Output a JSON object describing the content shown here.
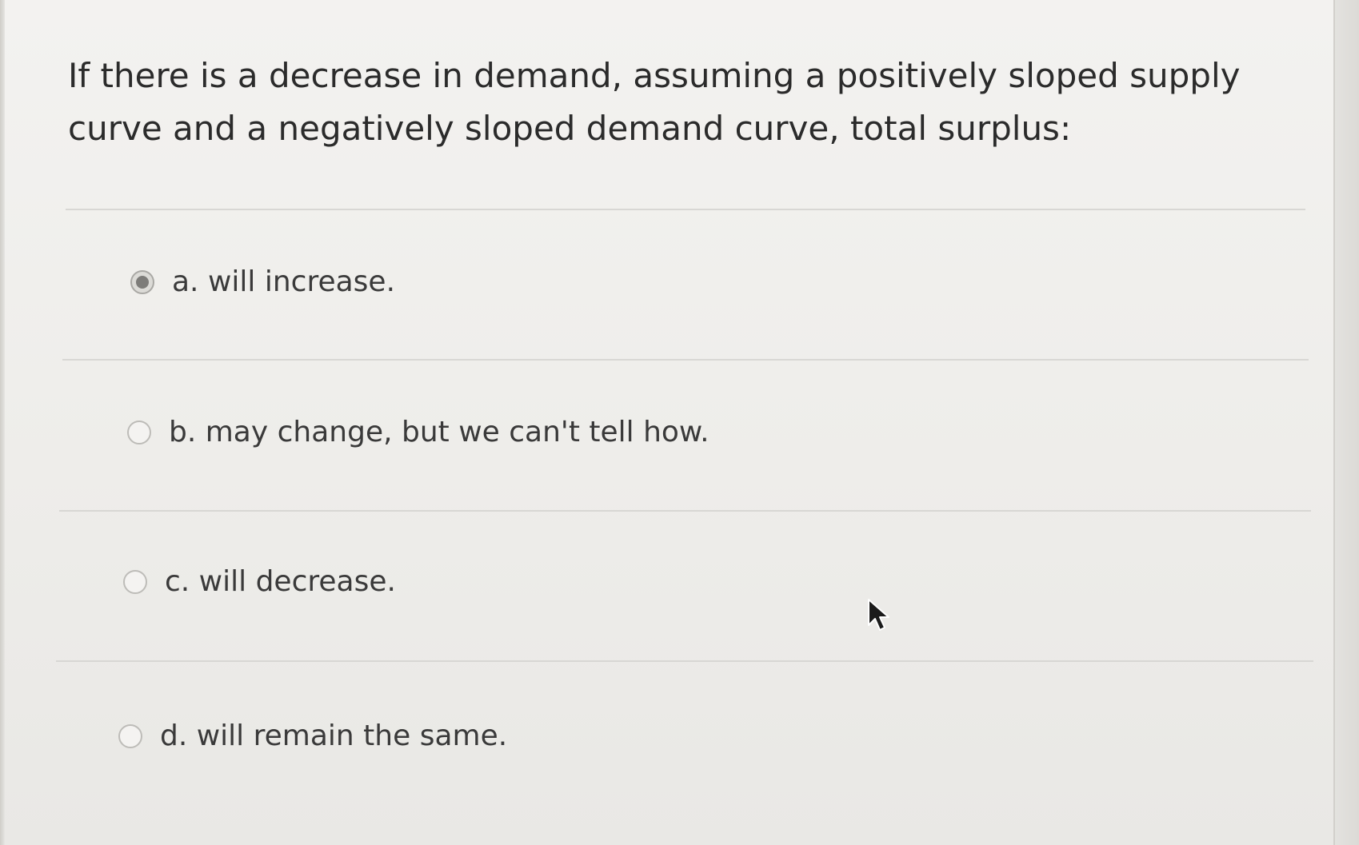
{
  "question": {
    "text": "If there is a decrease in demand, assuming a positively sloped supply curve and a negatively sloped demand curve, total surplus:"
  },
  "options": [
    {
      "label": "a. will increase.",
      "selected": true
    },
    {
      "label": "b. may change, but we can't tell how.",
      "selected": false
    },
    {
      "label": "c. will decrease.",
      "selected": false
    },
    {
      "label": "d. will remain the same.",
      "selected": false
    }
  ],
  "icons": {
    "radio": "radio-button-icon",
    "cursor": "mouse-pointer-icon"
  },
  "colors": {
    "background": "#efeeeb",
    "text": "#2b2b2b",
    "radio_selected_dot": "#7d7c79",
    "divider": "#d8d7d4"
  }
}
